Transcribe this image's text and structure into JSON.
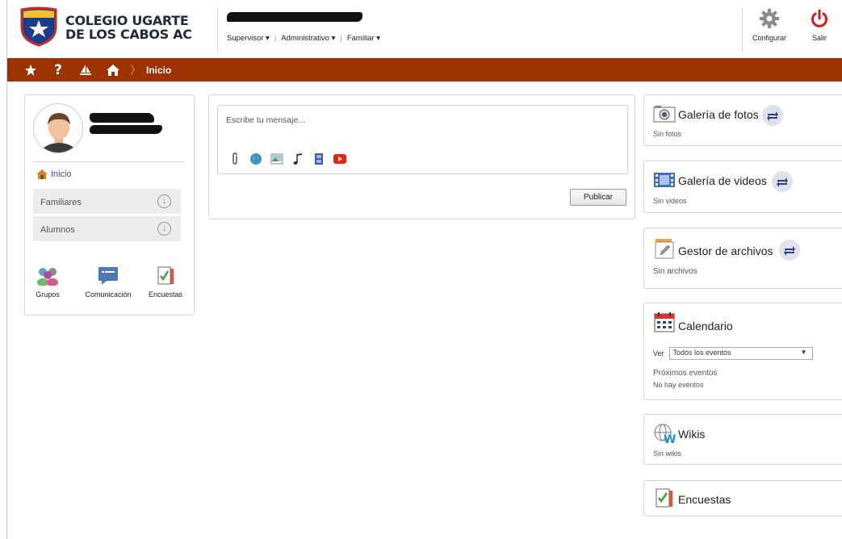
{
  "header": {
    "school_line1": "COLEGIO UGARTE",
    "school_line2": "DE LOS CABOS AC",
    "roles": [
      "Supervisor ▾",
      "Administrativo ▾",
      "Familiar ▾"
    ],
    "configure_label": "Configurar",
    "logout_label": "Salir"
  },
  "navbar": {
    "icons": [
      "star-icon",
      "help-icon",
      "sailboat-icon",
      "home-icon"
    ],
    "help_glyph": "?",
    "breadcrumb": "Inicio"
  },
  "profile": {
    "home_link": "Inicio",
    "rows": [
      "Familiares",
      "Alumnos"
    ],
    "quick_actions": [
      "Grupos",
      "Comunicación",
      "Encuestas"
    ]
  },
  "composer": {
    "placeholder": "Escribe tu mensaje...",
    "attachments": [
      "paperclip-icon",
      "globe-icon",
      "image-icon",
      "music-icon",
      "video-icon",
      "youtube-icon"
    ],
    "publish_label": "Publicar"
  },
  "widgets": {
    "photos": {
      "title": "Galería de fotos",
      "sub": "Sin fotos"
    },
    "videos": {
      "title": "Galería de videos",
      "sub": "Sin videos"
    },
    "files": {
      "title": "Gestor de archivos",
      "sub": "Sin archivos"
    },
    "calendar": {
      "title": "Calendario",
      "view_label": "Ver",
      "view_selected": "Todos los eventos",
      "upcoming_label": "Próximos eventos",
      "no_events": "No hay eventos"
    },
    "wikis": {
      "title": "Wikis",
      "sub": "Sin wikis"
    },
    "surveys": {
      "title": "Encuestas"
    }
  },
  "colors": {
    "navbar": "#9b3200",
    "link": "#3c4ea3",
    "logout": "#c9211e"
  }
}
